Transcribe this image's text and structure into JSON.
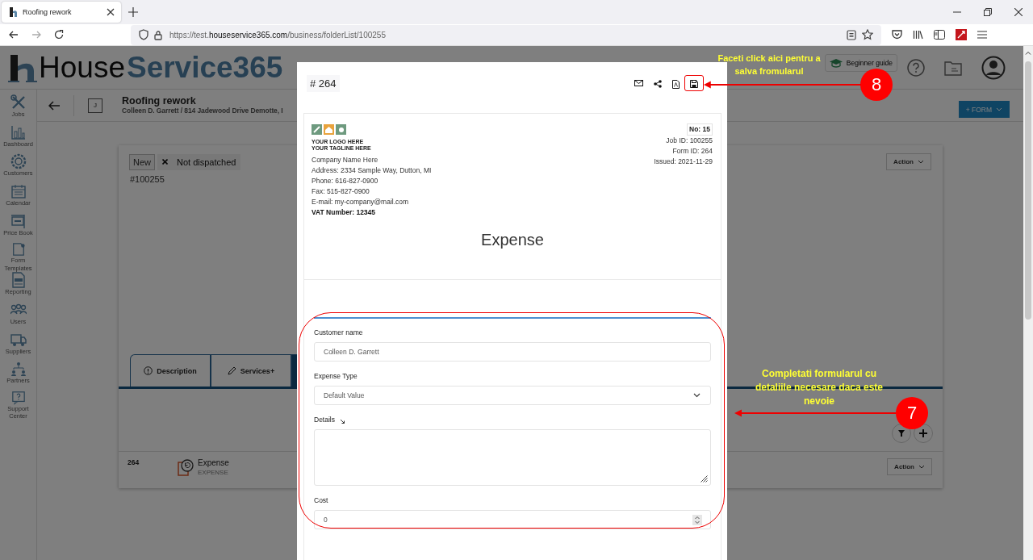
{
  "browser": {
    "tab_title": "Roofing rework",
    "url_prefix": "https://test.",
    "url_domain": "houseservice365.com",
    "url_path": "/business/folderList/100255"
  },
  "app": {
    "logo": {
      "first": "House",
      "second": "Service365"
    },
    "guide_button": "Beginner guide",
    "sidebar": [
      {
        "label": "Jobs"
      },
      {
        "label": "Dashboard"
      },
      {
        "label": "Customers"
      },
      {
        "label": "Calendar"
      },
      {
        "label": "Price Book"
      },
      {
        "label": "Form Templates"
      },
      {
        "label": "Reporting"
      },
      {
        "label": "Users"
      },
      {
        "label": "Suppliers"
      },
      {
        "label": "Partners"
      },
      {
        "label": "Support Center"
      }
    ],
    "job": {
      "badge": "J",
      "title": "Roofing rework",
      "subtitle": "Colleen D. Garrett / 814 Jadewood Drive Demotte, I",
      "form_button": "+ FORM"
    },
    "card": {
      "status": "New",
      "dispatch": "Not dispatched",
      "number": "#100255",
      "action": "Action",
      "tabs": [
        {
          "label": "Description",
          "selected": false
        },
        {
          "label": "Services+",
          "selected": false
        },
        {
          "selected": true
        }
      ],
      "rows": [
        {
          "number": "264",
          "name": "Expense",
          "type": "EXPENSE",
          "action": "Action"
        }
      ]
    }
  },
  "modal": {
    "title": "# 264",
    "document": {
      "logo_text": "YOUR LOGO HERE",
      "logo_tagline": "YOUR TAGLINE HERE",
      "company_lines": [
        "Company Name Here",
        "Address: 2334 Sample Way, Dutton, MI",
        "Phone: 616-827-0900",
        "Fax: 515-827-0900",
        "E-mail: my-company@mail.com"
      ],
      "vat": "VAT Number: 12345",
      "no": "No: 15",
      "meta": [
        "Job ID: 100255",
        "Form ID: 264",
        "Issued: 2021-11-29"
      ],
      "heading": "Expense"
    },
    "fields": [
      {
        "kind": "text",
        "label": "Customer name",
        "value": "Colleen D. Garrett"
      },
      {
        "kind": "select",
        "label": "Expense Type",
        "value": "Default Value"
      },
      {
        "kind": "textarea",
        "label": "Details"
      },
      {
        "kind": "number",
        "label": "Cost",
        "value": "0"
      }
    ]
  },
  "annotations": [
    {
      "number": "8",
      "text": "Faceti click aici pentru a salva fromularul"
    },
    {
      "number": "7",
      "text": "Completati formularul cu detaliile necesare daca este nevoie"
    }
  ]
}
